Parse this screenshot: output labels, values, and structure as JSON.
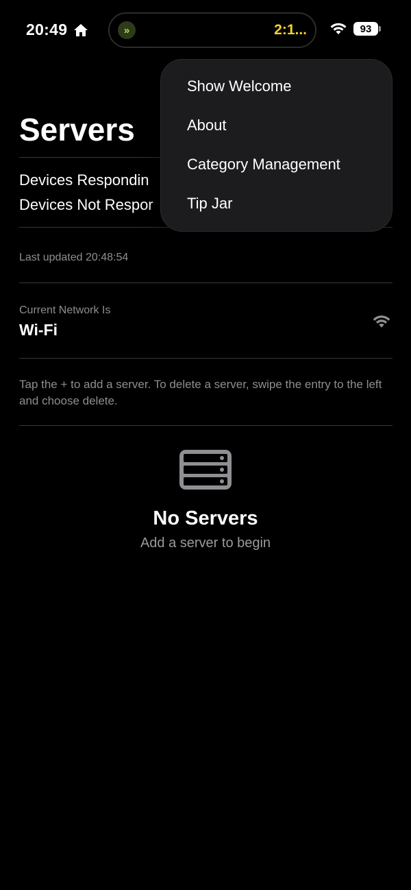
{
  "status_bar": {
    "time": "20:49",
    "island_timer": "2:1...",
    "battery_level": "93",
    "colors": {
      "timer": "#f5d328",
      "island_icon": "#b5e53a"
    }
  },
  "page": {
    "title": "Servers",
    "devices_responding_label": "Devices Respondin",
    "devices_not_responding_label": "Devices Not Respor",
    "last_updated": "Last updated 20:48:54",
    "network_label": "Current Network Is",
    "network_value": "Wi-Fi",
    "help_text": "Tap the + to add a server. To delete a server, swipe the entry to the left and choose delete."
  },
  "empty_state": {
    "icon": "server-rack-icon",
    "title": "No Servers",
    "subtitle": "Add a server to begin"
  },
  "menu": {
    "items": [
      {
        "label": "Show Welcome"
      },
      {
        "label": "About"
      },
      {
        "label": "Category Management"
      },
      {
        "label": "Tip Jar"
      }
    ]
  }
}
